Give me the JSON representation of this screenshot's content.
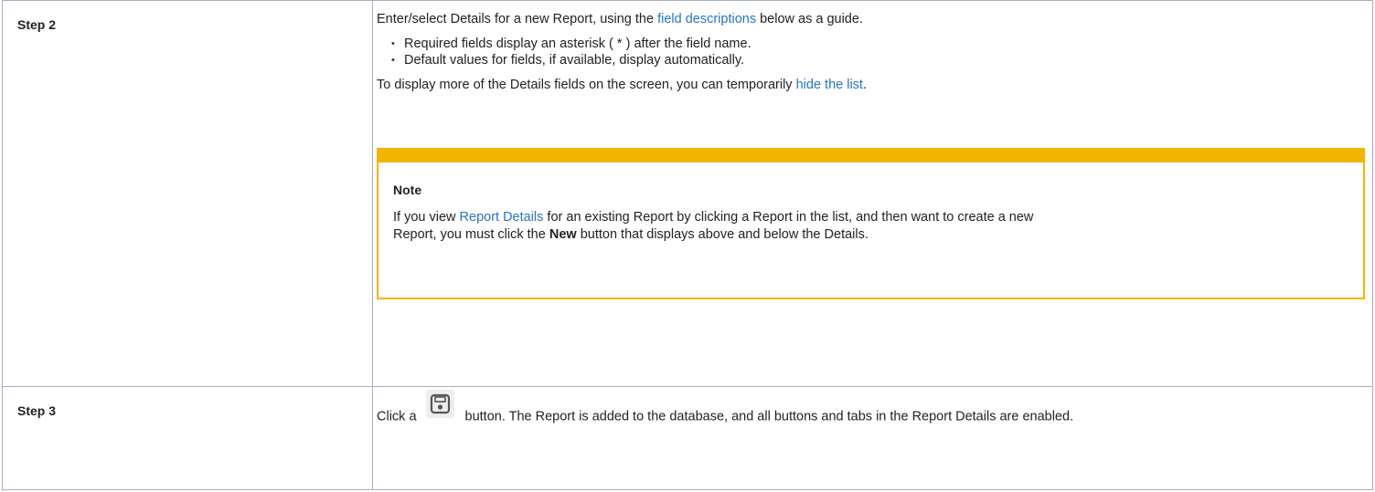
{
  "steps": [
    {
      "label": "Step 2",
      "intro_before": "Enter/select Details for a new Report, using the ",
      "intro_link": "field descriptions",
      "intro_after": " below as a guide.",
      "bullets": [
        "Required fields display an asterisk ( * ) after the field name.",
        "Default values for fields, if available, display automatically."
      ],
      "hide_before": "To display more of the Details fields on the screen, you can temporarily ",
      "hide_link": "hide the list",
      "hide_after": ".",
      "note": {
        "title": "Note",
        "body_before": "If you view ",
        "body_link": "Report Details",
        "body_middle": " for an existing Report by clicking a Report in the list, and then want to create a new Report, you must click the ",
        "body_bold": "New",
        "body_after": " button that displays above and below the Details."
      }
    },
    {
      "label": "Step 3",
      "text_before": "Click a",
      "button_icon": "save-icon",
      "text_after": "button. The Report is added to the database, and all buttons and tabs in the Report Details are enabled."
    }
  ],
  "colors": {
    "link": "#2a73c9",
    "note_accent": "#f5b400",
    "border": "#a9aebe"
  }
}
